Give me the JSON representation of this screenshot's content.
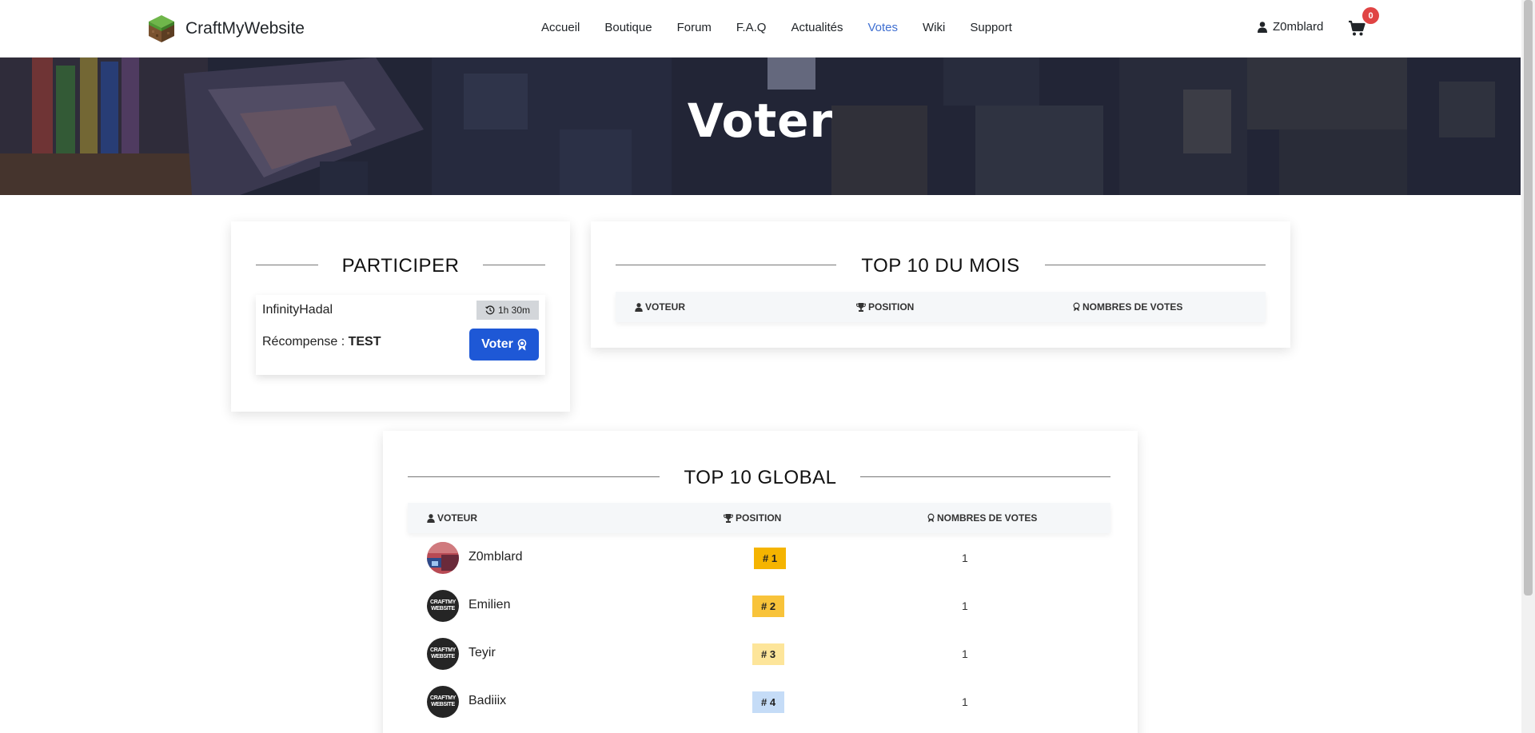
{
  "brand": {
    "name": "CraftMyWebsite"
  },
  "nav": {
    "items": [
      {
        "label": "Accueil",
        "active": false
      },
      {
        "label": "Boutique",
        "active": false
      },
      {
        "label": "Forum",
        "active": false
      },
      {
        "label": "F.A.Q",
        "active": false
      },
      {
        "label": "Actualités",
        "active": false
      },
      {
        "label": "Votes",
        "active": true
      },
      {
        "label": "Wiki",
        "active": false
      },
      {
        "label": "Support",
        "active": false
      }
    ]
  },
  "user": {
    "name": "Z0mblard",
    "icon": "user-icon"
  },
  "cart": {
    "count": "0",
    "icon": "shopping-cart-icon"
  },
  "hero": {
    "title": "Voter"
  },
  "participer": {
    "title": "PARTICIPER",
    "site": {
      "name": "InfinityHadal",
      "timer": "1h 30m"
    },
    "reward_label": "Récompense : ",
    "reward_value": "TEST",
    "vote_button": "Voter"
  },
  "top_mois": {
    "title": "TOP 10 DU MOIS",
    "headers": {
      "voter": "VOTEUR",
      "position": "POSITION",
      "votes": "NOMBRES DE VOTES"
    }
  },
  "top_global": {
    "title": "TOP 10 GLOBAL",
    "headers": {
      "voter": "VOTEUR",
      "position": "POSITION",
      "votes": "NOMBRES DE VOTES"
    },
    "rows": [
      {
        "name": "Z0mblard",
        "position": "# 1",
        "votes": "1",
        "badge_color": "#f5b400",
        "avatar": "custom"
      },
      {
        "name": "Emilien",
        "position": "# 2",
        "votes": "1",
        "badge_color": "#f8c33a",
        "avatar": "cmw"
      },
      {
        "name": "Teyir",
        "position": "# 3",
        "votes": "1",
        "badge_color": "#fde59a",
        "avatar": "cmw"
      },
      {
        "name": "Badiiix",
        "position": "# 4",
        "votes": "1",
        "badge_color": "#c5dcf7",
        "avatar": "cmw"
      }
    ]
  },
  "avatar_logo_text": [
    "CRAFTMY",
    "WEBSITE"
  ],
  "colors": {
    "accent": "#1e58d6",
    "active_nav": "#3f6fd1",
    "badge": "#e04444"
  }
}
